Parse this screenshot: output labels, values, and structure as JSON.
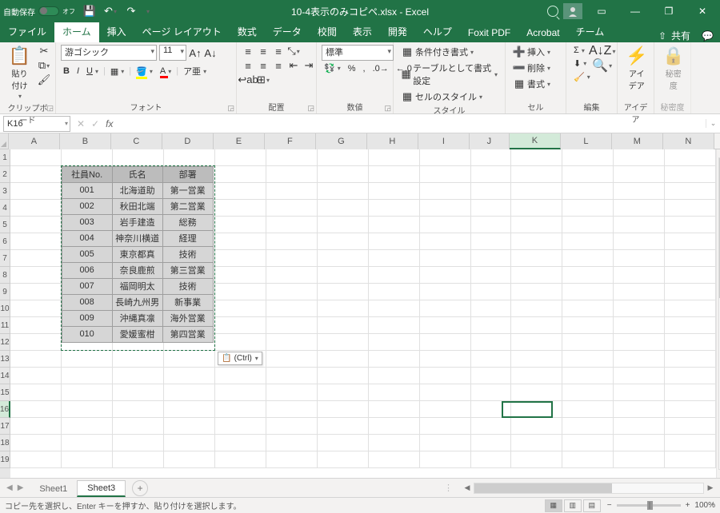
{
  "title": {
    "autosave_label": "自動保存",
    "autosave_state": "オフ",
    "filename": "10-4表示のみコピペ.xlsx",
    "appname": "Excel",
    "sep": " - "
  },
  "winbuttons": {
    "min": "—",
    "restore": "❐",
    "close": "✕"
  },
  "tabs": {
    "file": "ファイル",
    "home": "ホーム",
    "insert": "挿入",
    "layout": "ページ レイアウト",
    "formulas": "数式",
    "data": "データ",
    "review": "校閲",
    "view": "表示",
    "dev": "開発",
    "help": "ヘルプ",
    "foxit": "Foxit PDF",
    "acrobat": "Acrobat",
    "team": "チーム",
    "share": "共有"
  },
  "ribbon": {
    "clipboard": {
      "label": "クリップボード",
      "paste": "貼り付け"
    },
    "font": {
      "label": "フォント",
      "name": "游ゴシック",
      "size": "11"
    },
    "align": {
      "label": "配置",
      "wrap": ""
    },
    "number": {
      "label": "数値",
      "format": "標準"
    },
    "styles": {
      "label": "スタイル",
      "cond": "条件付き書式",
      "table": "テーブルとして書式設定",
      "cell": "セルのスタイル"
    },
    "cells": {
      "label": "セル",
      "insert": "挿入",
      "delete": "削除",
      "format": "書式"
    },
    "editing": {
      "label": "編集"
    },
    "ideas": {
      "label": "アイデア",
      "btn": "アイ\nデア"
    },
    "sensitivity": {
      "label": "秘密度",
      "btn": "秘密\n度"
    }
  },
  "namebox": "K16",
  "columns": [
    "A",
    "B",
    "C",
    "D",
    "E",
    "F",
    "G",
    "H",
    "I",
    "J",
    "K",
    "L",
    "M",
    "N"
  ],
  "rows": [
    "1",
    "2",
    "3",
    "4",
    "5",
    "6",
    "7",
    "8",
    "9",
    "10",
    "11",
    "12",
    "13",
    "14",
    "15",
    "16",
    "17",
    "18",
    "19"
  ],
  "table": {
    "headers": [
      "社員No.",
      "氏名",
      "部署"
    ],
    "data": [
      [
        "001",
        "北海道助",
        "第一営業"
      ],
      [
        "002",
        "秋田北端",
        "第二営業"
      ],
      [
        "003",
        "岩手建造",
        "総務"
      ],
      [
        "004",
        "神奈川横道",
        "経理"
      ],
      [
        "005",
        "東京都真",
        "技術"
      ],
      [
        "006",
        "奈良鹿煎",
        "第三営業"
      ],
      [
        "007",
        "福岡明太",
        "技術"
      ],
      [
        "008",
        "長崎九州男",
        "新事業"
      ],
      [
        "009",
        "沖縄真凛",
        "海外営業"
      ],
      [
        "010",
        "愛媛蜜柑",
        "第四営業"
      ]
    ]
  },
  "paste_options": "(Ctrl)",
  "sheets": {
    "s1": "Sheet1",
    "s3": "Sheet3"
  },
  "status": "コピー先を選択し、Enter キーを押すか、貼り付けを選択します。",
  "zoom": {
    "minus": "−",
    "plus": "+",
    "pct": "100%"
  }
}
